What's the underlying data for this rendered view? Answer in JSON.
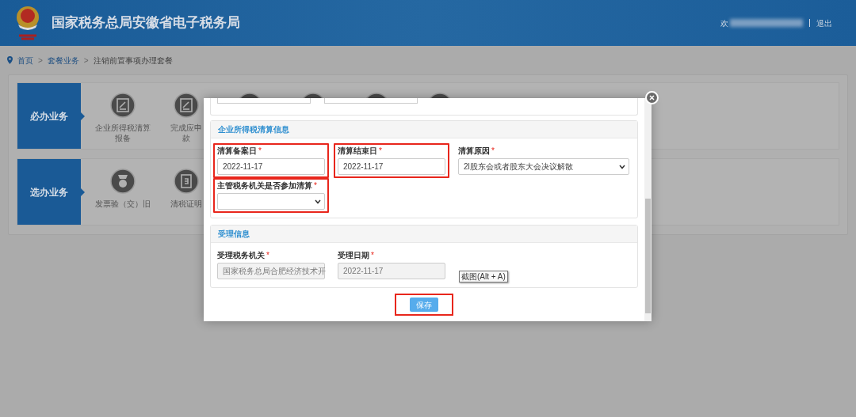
{
  "header": {
    "title": "国家税务总局安徽省电子税务局",
    "greeting": "欢",
    "logout": "退出"
  },
  "breadcrumb": {
    "separator": ">",
    "items": [
      {
        "label": "首页",
        "link": true
      },
      {
        "label": "套餐业务",
        "link": true
      },
      {
        "label": "注销前置事项办理套餐",
        "link": false
      }
    ]
  },
  "groups": [
    {
      "title": "必办业务",
      "items": [
        {
          "kind": "pen",
          "lines": [
            "企业所得税清算",
            "报备"
          ]
        },
        {
          "kind": "pen",
          "lines": [
            "完成应申",
            "款"
          ]
        },
        {
          "kind": "pen"
        },
        {
          "kind": "pen"
        },
        {
          "kind": "pen"
        },
        {
          "kind": "pen"
        }
      ]
    },
    {
      "title": "选办业务",
      "items": [
        {
          "kind": "medal",
          "lines": [
            "发票验（交）旧"
          ]
        },
        {
          "kind": "doc",
          "lines": [
            "清税证明"
          ]
        }
      ]
    }
  ],
  "dialog": {
    "sections": [
      {
        "title": "企业所得税清算信息",
        "fields": [
          {
            "label": "清算备案日",
            "mark": "*",
            "kind": "input",
            "value": "2022-11-17",
            "disabled": false,
            "highlighted": true
          },
          {
            "label": "清算结束日",
            "mark": "*",
            "kind": "input",
            "value": "2022-11-17",
            "disabled": false,
            "highlighted": true
          },
          {
            "label": "清算原因",
            "mark": "*",
            "kind": "select",
            "value": "2l股东会或者股东大会决议解散",
            "disabled": false,
            "highlighted": false
          },
          {
            "label": "主管税务机关是否参加清算",
            "mark": "*",
            "kind": "select",
            "disabled": false,
            "highlighted": true
          }
        ]
      },
      {
        "title": "受理信息",
        "fields": [
          {
            "label": "受理税务机关",
            "mark": "*",
            "kind": "input",
            "value": "国家税务总局合肥经济技术开",
            "disabled": true,
            "highlighted": false
          },
          {
            "label": "受理日期",
            "mark": "*",
            "kind": "input",
            "value": "2022-11-17",
            "disabled": true,
            "highlighted": false
          }
        ]
      }
    ],
    "tooltip": "截图(Alt + A)",
    "save": {
      "label": "保存",
      "highlighted": true
    }
  }
}
